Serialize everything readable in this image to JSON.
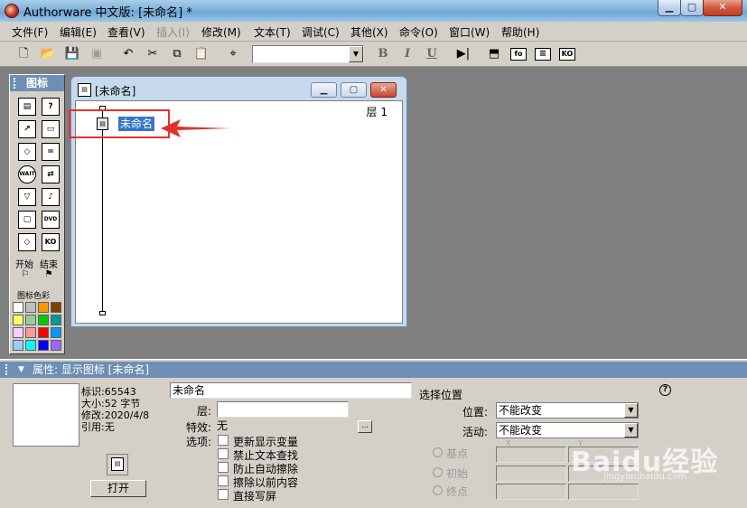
{
  "window": {
    "title": "Authorware 中文版: [未命名] *"
  },
  "menu": [
    "文件(F)",
    "编辑(E)",
    "查看(V)",
    "插入(I)",
    "修改(M)",
    "文本(T)",
    "调试(C)",
    "其他(X)",
    "命令(O)",
    "窗口(W)",
    "帮助(H)"
  ],
  "menu_disabled_index": 3,
  "toolbar": {
    "font_select_value": "",
    "bold": "B",
    "italic": "I",
    "underline": "U",
    "fo_label": "fo",
    "ko_label": "KO"
  },
  "palette": {
    "title": "图标",
    "start_label": "开始",
    "end_label": "结束",
    "colors_label": "图标色彩",
    "icon_wait_label": "WAIT",
    "icon_dvd_label": "DVD",
    "icon_ko_label": "KO",
    "swatches": [
      "#ffffff",
      "#c0c0c0",
      "#ff9900",
      "#7f3f00",
      "#ffff66",
      "#99cc99",
      "#00cc00",
      "#009999",
      "#ffccff",
      "#ff9999",
      "#ff0000",
      "#0099ff",
      "#99ccff",
      "#00ffff",
      "#0000ff",
      "#9966ff"
    ]
  },
  "flow_window": {
    "title": "[未命名]",
    "layer": "层 1",
    "icon_label": "未命名"
  },
  "properties": {
    "title": "属性: 显示图标 [未命名]",
    "id": "标识:65543",
    "size": "大小:52 字节",
    "modified": "修改:2020/4/8",
    "reference": "引用:无",
    "open_button": "打开",
    "name_value": "未命名",
    "layer_label": "层:",
    "layer_value": "",
    "effect_label": "特效:",
    "effect_value": "无",
    "options_label": "选项:",
    "options": [
      "更新显示变量",
      "禁止文本查找",
      "防止自动擦除",
      "擦除以前内容",
      "直接写屏"
    ],
    "choose_position": "选择位置",
    "position_label": "位置:",
    "position_value": "不能改变",
    "activity_label": "活动:",
    "activity_value": "不能改变",
    "base_point": "基点",
    "initial": "初始",
    "end_point": "终点",
    "x_label": "X",
    "y_label": "Y",
    "help_symbol": "?"
  },
  "watermark": {
    "brand": "Baidu经验",
    "url": "jingyan.baidu.com"
  }
}
